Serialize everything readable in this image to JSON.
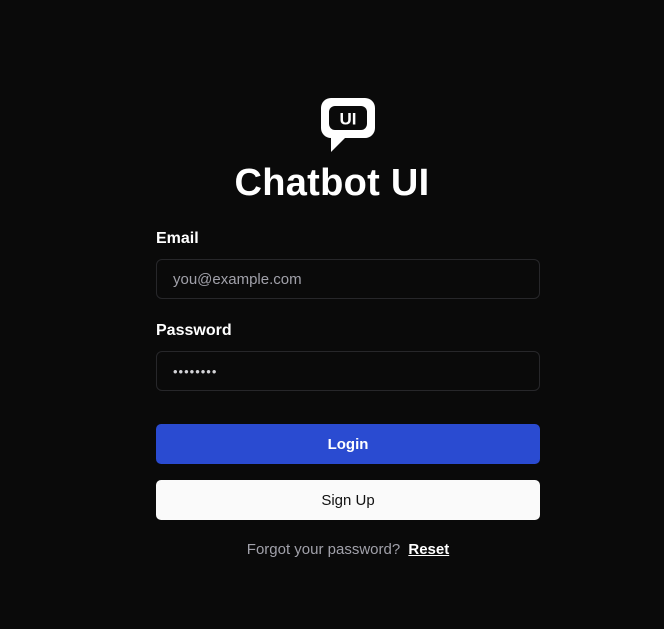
{
  "brand": {
    "logo_icon": "chat-bubble-ui-logo",
    "logo_text": "UI",
    "title": "Chatbot UI"
  },
  "form": {
    "email_label": "Email",
    "email_placeholder": "you@example.com",
    "email_value": "",
    "password_label": "Password",
    "password_value": "password",
    "login_label": "Login",
    "signup_label": "Sign Up",
    "forgot_text": "Forgot your password?",
    "reset_label": "Reset"
  },
  "colors": {
    "background": "#0a0a0a",
    "login_button": "#2a4bd1",
    "signup_button": "#fafafa",
    "input_border": "#27272a"
  }
}
